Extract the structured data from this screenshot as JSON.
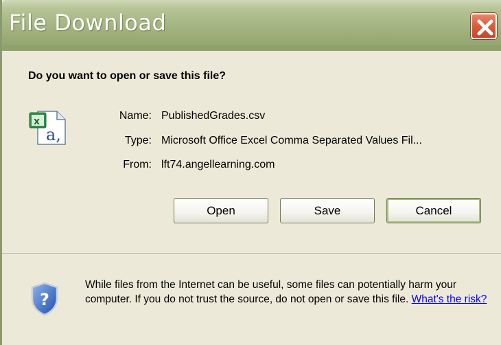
{
  "window": {
    "title": "File Download",
    "title_bar_color": "#a5b583",
    "close_button_color": "#d9603f"
  },
  "dialog": {
    "question": "Do you want to open or save this file?",
    "file_icon": "excel-csv-file-icon",
    "fields": {
      "name_label": "Name:",
      "name_value": "PublishedGrades.csv",
      "type_label": "Type:",
      "type_value": "Microsoft Office Excel Comma Separated Values Fil...",
      "from_label": "From:",
      "from_value": "lft74.angellearning.com"
    },
    "buttons": {
      "open": "Open",
      "save": "Save",
      "cancel": "Cancel"
    },
    "warning": {
      "icon": "security-shield-question-icon",
      "text": "While files from the Internet can be useful, some files can potentially harm your computer. If you do not trust the source, do not open or save this file.",
      "link": "What's the risk?"
    }
  }
}
